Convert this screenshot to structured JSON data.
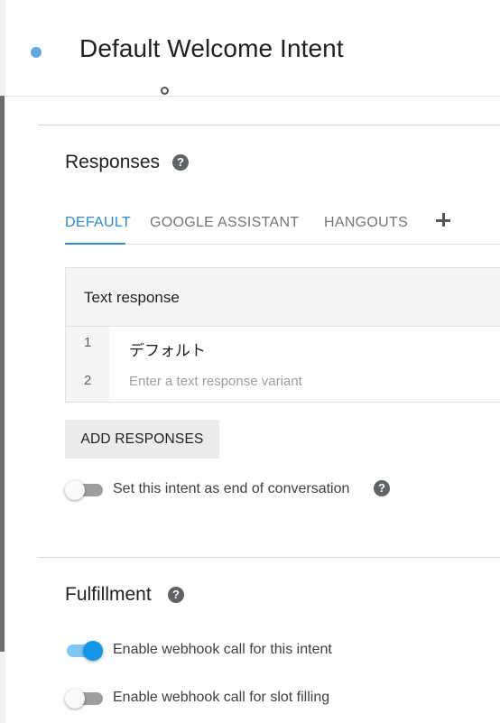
{
  "header": {
    "title": "Default Welcome Intent"
  },
  "responses": {
    "title": "Responses",
    "tabs": [
      {
        "label": "DEFAULT"
      },
      {
        "label": "GOOGLE ASSISTANT"
      },
      {
        "label": "HANGOUTS"
      }
    ],
    "card": {
      "title": "Text response",
      "rows": [
        {
          "num": "1",
          "text": "デフォルト"
        },
        {
          "num": "2",
          "placeholder": "Enter a text response variant"
        }
      ]
    },
    "add_button": "ADD RESPONSES",
    "end_conversation": {
      "label": "Set this intent as end of conversation",
      "enabled": false
    }
  },
  "fulfillment": {
    "title": "Fulfillment",
    "webhook_intent": {
      "label": "Enable webhook call for this intent",
      "enabled": true
    },
    "webhook_slot": {
      "label": "Enable webhook call for slot filling",
      "enabled": false
    }
  },
  "colors": {
    "accent": "#2a8bd0",
    "toggle_on": "#1297e8",
    "status_dot": "#62a8e0"
  }
}
